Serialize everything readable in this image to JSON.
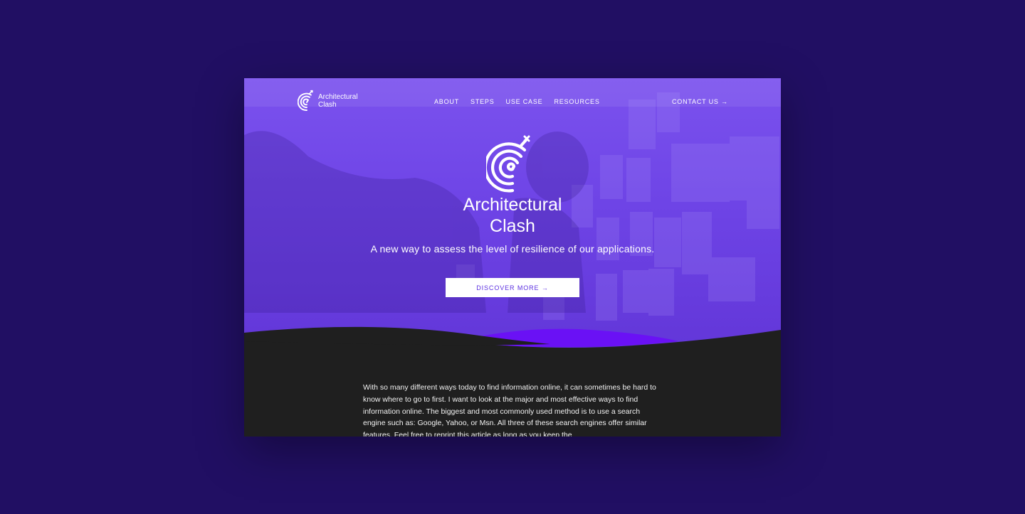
{
  "brand": {
    "name_line1": "Architectural",
    "name_line2": "Clash"
  },
  "nav": {
    "items": [
      "ABOUT",
      "STEPS",
      "USE CASE",
      "RESOURCES"
    ],
    "contact_label": "CONTACT US →"
  },
  "hero": {
    "title_line1": "Architectural",
    "title_line2": "Clash",
    "tagline": "A new way to assess the level of resilience of our applications.",
    "cta_label": "DISCOVER MORE →"
  },
  "content": {
    "paragraph": "With so many different ways today to find information online, it can sometimes be hard to know where to go to first. I want to look at the major and most effective ways to find information online. The biggest and most commonly used method is to use a search engine such as: Google, Yahoo, or Msn. All three of these search engines offer similar features. Feel free to reprint this article as long as you keep the"
  },
  "colors": {
    "page_bg": "#210f63",
    "hero_purple": "#7148ea",
    "accent_violet": "#6a11f5",
    "dark_section": "#1f1f1f",
    "cta_text": "#5a2ee0"
  },
  "icons": [
    "spiral-logo-icon",
    "arrow-right-icon"
  ]
}
